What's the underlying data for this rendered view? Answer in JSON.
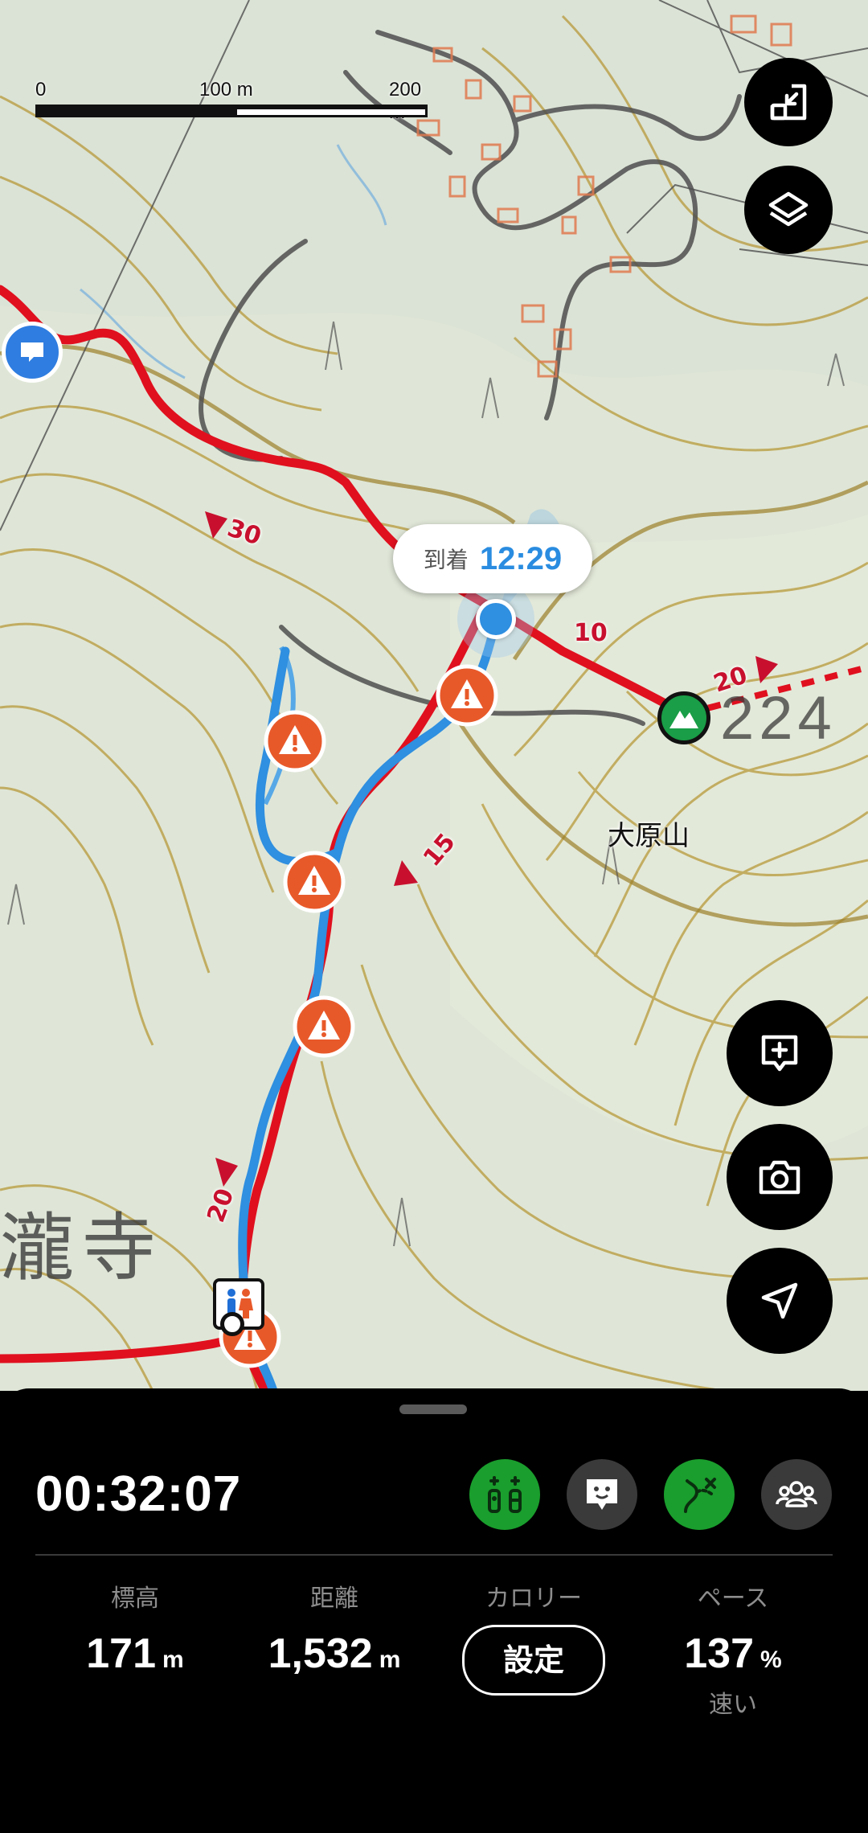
{
  "map": {
    "scale": {
      "label_0": "0",
      "label_100": "100 m",
      "label_200": "200 m"
    },
    "arrival": {
      "label": "到着",
      "time": "12:29"
    },
    "mountain_name": "大原山",
    "place_name": "瀧寺",
    "contour_number": "224",
    "segment_times": {
      "a": "30",
      "b": "10",
      "c": "20",
      "d": "15",
      "e": "20"
    },
    "colors": {
      "route": "#e0101f",
      "track": "#2f8fe0",
      "warning": "#e8592a",
      "peak": "#1a9e47",
      "contour": "#b79a3a",
      "water": "#57a8e6",
      "road": "#555555",
      "building": "#e07a4f"
    }
  },
  "controls": {
    "exit_fullscreen_icon": "exit-fullscreen-icon",
    "layers_icon": "layers-icon",
    "add_memo_icon": "add-memo-icon",
    "camera_icon": "camera-icon",
    "navigation_icon": "navigation-arrow-icon"
  },
  "panel": {
    "elapsed_time": "00:32:07",
    "stats": {
      "elevation": {
        "label": "標高",
        "value": "171",
        "unit": "m"
      },
      "distance": {
        "label": "距離",
        "value": "1,532",
        "unit": "m"
      },
      "calories": {
        "label": "カロリー",
        "button": "設定"
      },
      "pace": {
        "label": "ペース",
        "value": "137",
        "unit": "%",
        "note": "速い"
      }
    }
  }
}
